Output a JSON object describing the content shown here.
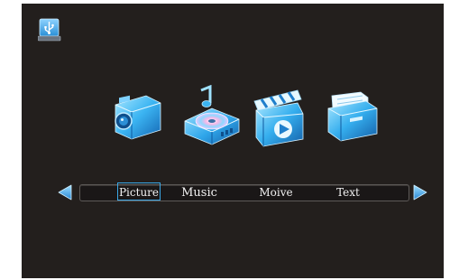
{
  "header": {
    "usb_icon": "usb-drive-icon"
  },
  "media_icons": [
    {
      "name": "camera-icon"
    },
    {
      "name": "music-disc-icon"
    },
    {
      "name": "clapperboard-icon"
    },
    {
      "name": "folder-document-icon"
    }
  ],
  "menu": {
    "items": [
      {
        "label": "Picture"
      },
      {
        "label": "Music"
      },
      {
        "label": "Moive"
      },
      {
        "label": "Text"
      }
    ],
    "selected_label": "Picture"
  },
  "colors": {
    "background": "#231f1d",
    "accent": "#3aa7e6",
    "icon_blue": "#27a0e6",
    "text": "#f2f2f2"
  }
}
